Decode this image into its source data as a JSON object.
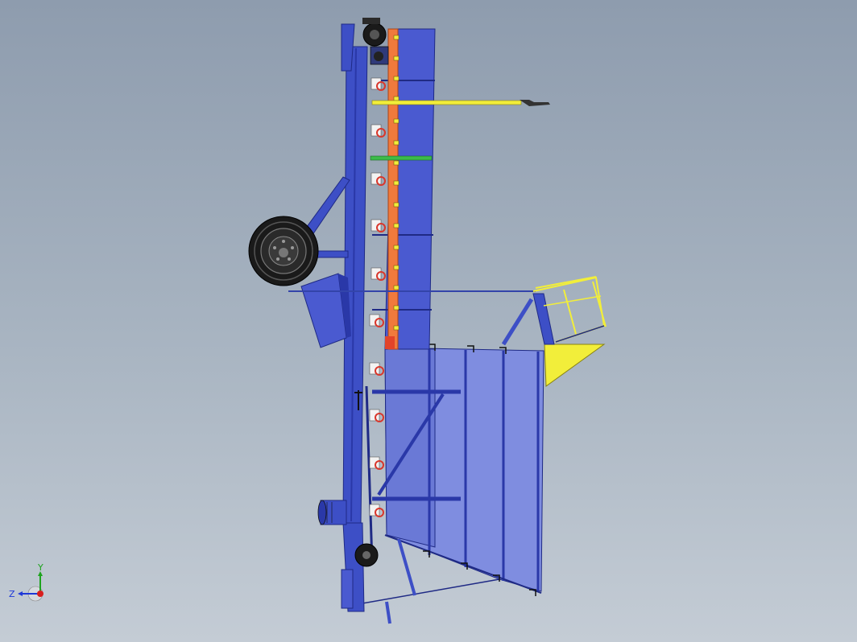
{
  "viewport": {
    "background_top": "#8e9cae",
    "background_bottom": "#c4ccd5"
  },
  "colors": {
    "frame_blue": "#3d4fc6",
    "frame_dark": "#1f2a85",
    "hopper_light": "#7f8de0",
    "hopper_mid": "#6a79d6",
    "conveyor_orange": "#f07a3c",
    "rail_yellow": "#f2ee3a",
    "rail_green": "#3cbb4a",
    "tire_black": "#1a1a1a",
    "roller_red": "#d8372c"
  },
  "triad": {
    "x_axis_color": "#d81e1e",
    "y_axis_color": "#1ea31e",
    "z_axis_color": "#1e38d8",
    "y_label": "Y",
    "z_label": "Z"
  }
}
